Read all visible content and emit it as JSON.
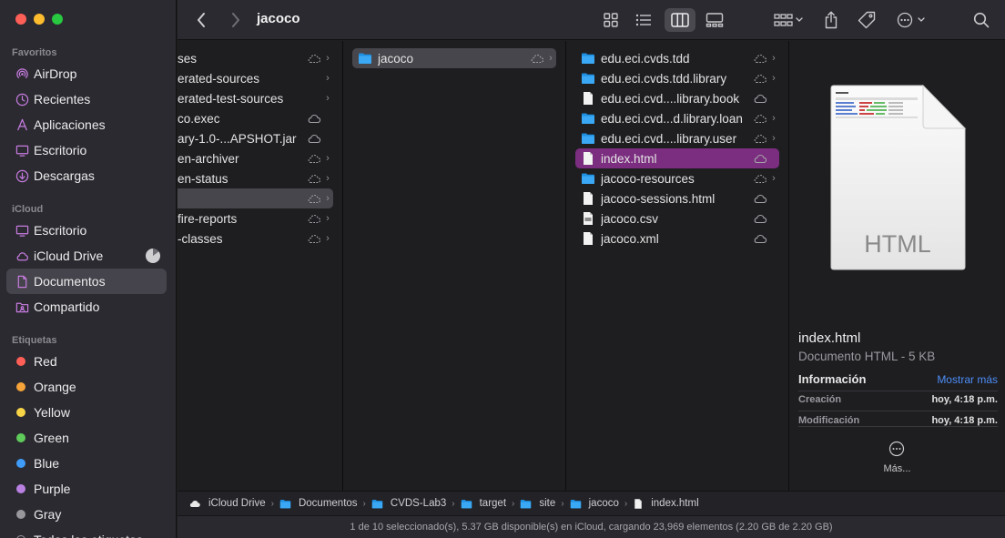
{
  "sidebar": {
    "favorites_title": "Favoritos",
    "favorites": [
      {
        "label": "AirDrop",
        "icon": "airdrop-icon"
      },
      {
        "label": "Recientes",
        "icon": "clock-icon"
      },
      {
        "label": "Aplicaciones",
        "icon": "applications-icon"
      },
      {
        "label": "Escritorio",
        "icon": "desktop-icon"
      },
      {
        "label": "Descargas",
        "icon": "download-icon"
      }
    ],
    "icloud_title": "iCloud",
    "icloud": [
      {
        "label": "Escritorio",
        "icon": "desktop-icon"
      },
      {
        "label": "iCloud Drive",
        "icon": "cloud-icon"
      },
      {
        "label": "Documentos",
        "icon": "document-icon",
        "selected": true
      },
      {
        "label": "Compartido",
        "icon": "shared-folder-icon"
      }
    ],
    "tags_title": "Etiquetas",
    "tags": [
      {
        "label": "Red",
        "color": "#ff5f57"
      },
      {
        "label": "Orange",
        "color": "#f6a33a"
      },
      {
        "label": "Yellow",
        "color": "#f8d447"
      },
      {
        "label": "Green",
        "color": "#5ecb5a"
      },
      {
        "label": "Blue",
        "color": "#3f9cf8"
      },
      {
        "label": "Purple",
        "color": "#b980e2"
      },
      {
        "label": "Gray",
        "color": "#98979c"
      }
    ],
    "tags_more": "Todas las etiquetas…"
  },
  "toolbar": {
    "title": "jacoco"
  },
  "column1": [
    {
      "name": "ses",
      "cloud": "dashed",
      "chevron": true
    },
    {
      "name": "erated-sources",
      "cloud": "none",
      "chevron": true
    },
    {
      "name": "erated-test-sources",
      "cloud": "none",
      "chevron": true
    },
    {
      "name": "co.exec",
      "cloud": "solid",
      "chevron": false
    },
    {
      "name": "ary-1.0-...APSHOT.jar",
      "cloud": "solid",
      "chevron": false
    },
    {
      "name": "en-archiver",
      "cloud": "dashed",
      "chevron": true
    },
    {
      "name": "en-status",
      "cloud": "dashed",
      "chevron": true
    },
    {
      "name": "",
      "cloud": "dashed",
      "chevron": true,
      "selected": true
    },
    {
      "name": "fire-reports",
      "cloud": "dashed",
      "chevron": true
    },
    {
      "name": "-classes",
      "cloud": "dashed",
      "chevron": true
    }
  ],
  "column2": [
    {
      "name": "jacoco",
      "type": "folder",
      "cloud": "dashed",
      "chevron": true,
      "selected": true
    }
  ],
  "column3": [
    {
      "name": "edu.eci.cvds.tdd",
      "type": "folder",
      "cloud": "dashed",
      "chevron": true
    },
    {
      "name": "edu.eci.cvds.tdd.library",
      "type": "folder",
      "cloud": "dashed",
      "chevron": true
    },
    {
      "name": "edu.eci.cvd....library.book",
      "type": "file",
      "cloud": "solid",
      "chevron": false
    },
    {
      "name": "edu.eci.cvd...d.library.loan",
      "type": "folder",
      "cloud": "dashed",
      "chevron": true
    },
    {
      "name": "edu.eci.cvd....library.user",
      "type": "folder",
      "cloud": "dashed",
      "chevron": true
    },
    {
      "name": "index.html",
      "type": "file",
      "cloud": "solid",
      "chevron": false,
      "selected": true
    },
    {
      "name": "jacoco-resources",
      "type": "folder",
      "cloud": "dashed",
      "chevron": true
    },
    {
      "name": "jacoco-sessions.html",
      "type": "file",
      "cloud": "solid",
      "chevron": false
    },
    {
      "name": "jacoco.csv",
      "type": "csv",
      "cloud": "solid",
      "chevron": false
    },
    {
      "name": "jacoco.xml",
      "type": "file",
      "cloud": "solid",
      "chevron": false
    }
  ],
  "preview": {
    "thumb_label": "HTML",
    "name": "index.html",
    "kind": "Documento HTML - 5 KB",
    "info_title": "Información",
    "show_more": "Mostrar más",
    "created_label": "Creación",
    "created_value": "hoy, 4:18 p.m.",
    "modified_label": "Modificación",
    "modified_value": "hoy, 4:18 p.m.",
    "more_label": "Más..."
  },
  "pathbar": [
    {
      "label": "iCloud Drive",
      "icon": "cloud-icon"
    },
    {
      "label": "Documentos",
      "icon": "folder-icon"
    },
    {
      "label": "CVDS-Lab3",
      "icon": "folder-icon"
    },
    {
      "label": "target",
      "icon": "folder-icon"
    },
    {
      "label": "site",
      "icon": "folder-icon"
    },
    {
      "label": "jacoco",
      "icon": "folder-icon"
    },
    {
      "label": "index.html",
      "icon": "file-icon"
    }
  ],
  "status": "1 de 10 seleccionado(s), 5.37 GB disponible(s) en iCloud, cargando 23,969 elementos (2.20 GB de 2.20 GB)",
  "colors": {
    "accent_selection": "#7b2d7f",
    "folder": "#2f9ff0",
    "link": "#4c8df6"
  }
}
